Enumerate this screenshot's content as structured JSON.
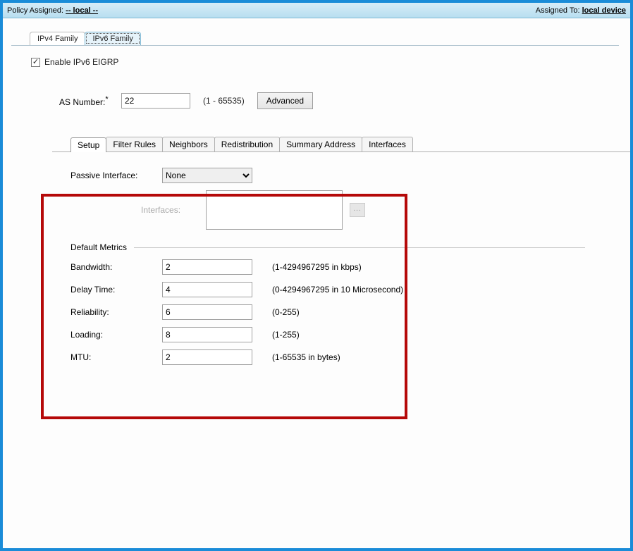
{
  "header": {
    "policy_label": "Policy Assigned:",
    "policy_value": "-- local --",
    "assigned_label": "Assigned To:",
    "assigned_value": "local device"
  },
  "top_tabs": {
    "ipv4": "IPv4 Family",
    "ipv6": "IPv6 Family"
  },
  "enable_checkbox": {
    "label": "Enable IPv6 EIGRP",
    "checked": true
  },
  "as_number": {
    "label": "AS Number:",
    "required_mark": "*",
    "value": "22",
    "hint": "(1 - 65535)"
  },
  "advanced_button": "Advanced",
  "sub_tabs": [
    "Setup",
    "Filter Rules",
    "Neighbors",
    "Redistribution",
    "Summary Address",
    "Interfaces"
  ],
  "setup": {
    "passive_label": "Passive Interface:",
    "passive_value": "None",
    "interfaces_label": "Interfaces:",
    "dots": "..."
  },
  "metrics": {
    "group_title": "Default Metrics",
    "rows": [
      {
        "label": "Bandwidth:",
        "value": "2",
        "hint": "(1-4294967295 in kbps)"
      },
      {
        "label": "Delay Time:",
        "value": "4",
        "hint": "(0-4294967295 in 10 Microsecond)"
      },
      {
        "label": "Reliability:",
        "value": "6",
        "hint": "(0-255)"
      },
      {
        "label": "Loading:",
        "value": "8",
        "hint": "(1-255)"
      },
      {
        "label": "MTU:",
        "value": "2",
        "hint": "(1-65535 in bytes)"
      }
    ]
  }
}
